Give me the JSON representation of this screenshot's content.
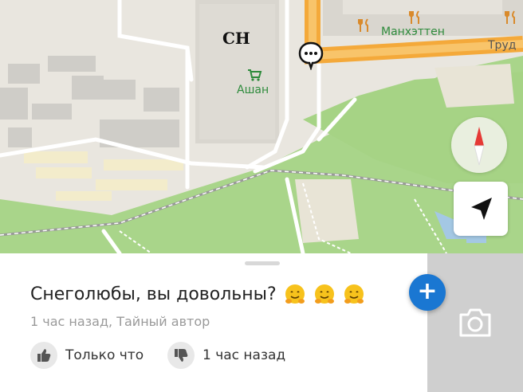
{
  "map": {
    "labels": {
      "building_ch": "СН",
      "store": "Ашан",
      "restaurant": "Манхэттен",
      "street": "Труд"
    },
    "colors": {
      "road_major": "#f4a93a",
      "park": "#a9d58a",
      "land": "#e9e6df",
      "building": "#d9d6cf"
    },
    "icons": [
      "cart-icon",
      "fork-knife-icon",
      "comment-bubble-icon",
      "compass-icon",
      "navigation-arrow-icon"
    ]
  },
  "post": {
    "title": "Снеголюбы, вы довольны?",
    "meta": "1 час назад, Тайный автор",
    "like_label": "Только что",
    "dislike_label": "1 час назад"
  },
  "actions": {
    "add_label": "+"
  },
  "colors": {
    "accent": "#1a77d2",
    "compass_red": "#e53935"
  }
}
